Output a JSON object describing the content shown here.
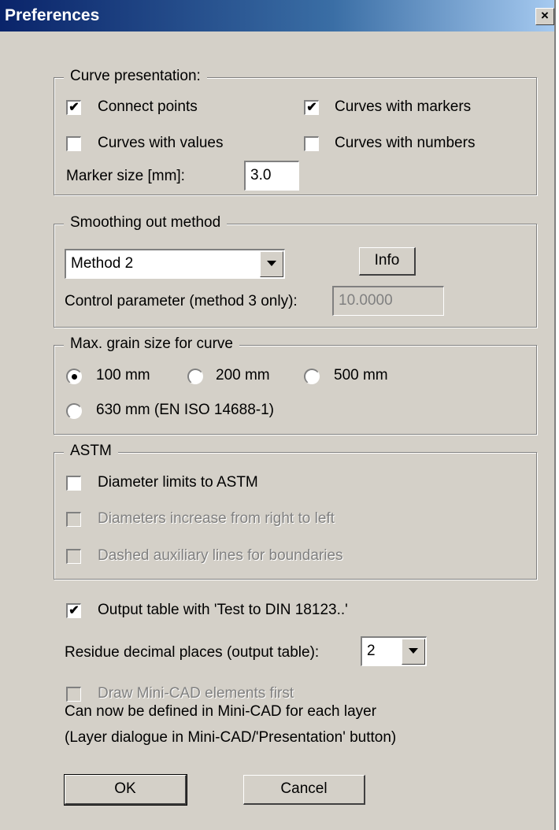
{
  "window": {
    "title": "Preferences",
    "close_glyph": "×"
  },
  "curve_presentation": {
    "legend": "Curve presentation:",
    "connect_points": {
      "label": "Connect points",
      "checked": true
    },
    "curves_with_markers": {
      "label": "Curves with markers",
      "checked": true
    },
    "curves_with_values": {
      "label": "Curves with values",
      "checked": false
    },
    "curves_with_numbers": {
      "label": "Curves with numbers",
      "checked": false
    },
    "marker_size_label": "Marker size [mm]:",
    "marker_size_value": "3.0"
  },
  "smoothing": {
    "legend": "Smoothing out method",
    "method_value": "Method 2",
    "info_label": "Info",
    "control_label": "Control parameter (method 3 only):",
    "control_value": "10.0000"
  },
  "grain": {
    "legend": "Max. grain size for curve",
    "options": [
      "100 mm",
      "200 mm",
      "500 mm",
      "630 mm (EN ISO 14688-1)"
    ],
    "selected": "100 mm"
  },
  "astm": {
    "legend": "ASTM",
    "diameter_limits": {
      "label": "Diameter limits to ASTM",
      "checked": false
    },
    "diameters_increase": {
      "label": "Diameters increase from right to left",
      "checked": false,
      "disabled": true
    },
    "dashed_lines": {
      "label": "Dashed auxiliary lines for boundaries",
      "checked": false,
      "disabled": true
    }
  },
  "output": {
    "table_label": "Output table with 'Test to DIN 18123..'",
    "table_checked": true,
    "residue_label": "Residue decimal places (output table):",
    "residue_value": "2"
  },
  "minicad": {
    "draw_first_label": "Draw Mini-CAD elements first",
    "note_line1": "Can now be defined in Mini-CAD for each layer",
    "note_line2": "(Layer dialogue in Mini-CAD/'Presentation' button)"
  },
  "buttons": {
    "ok": "OK",
    "cancel": "Cancel"
  },
  "check_glyph": "✔"
}
